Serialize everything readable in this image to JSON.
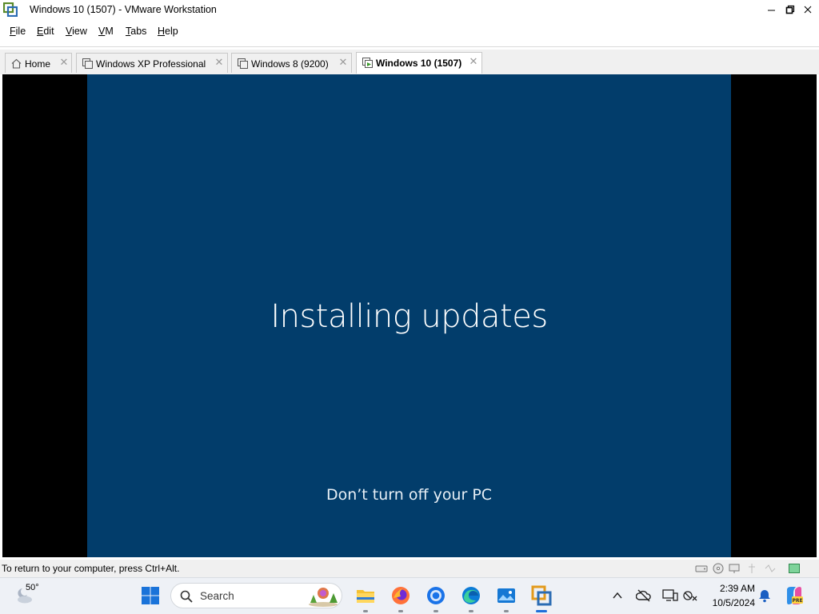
{
  "window": {
    "title": "Windows 10 (1507) - VMware Workstation"
  },
  "menu": {
    "items": [
      {
        "label": "File",
        "key": "F",
        "rest": "ile"
      },
      {
        "label": "Edit",
        "key": "E",
        "rest": "dit"
      },
      {
        "label": "View",
        "key": "V",
        "rest": "iew"
      },
      {
        "label": "VM",
        "key": "V",
        "rest": "M"
      },
      {
        "label": "Tabs",
        "key": "T",
        "rest": "abs"
      },
      {
        "label": "Help",
        "key": "H",
        "rest": "elp"
      }
    ]
  },
  "tabs": [
    {
      "label": "Home",
      "icon": "home-icon",
      "active": false
    },
    {
      "label": "Windows XP Professional",
      "icon": "vm-icon",
      "active": false
    },
    {
      "label": "Windows 8 (9200)",
      "icon": "vm-icon",
      "active": false
    },
    {
      "label": "Windows 10 (1507)",
      "icon": "vm-running-icon",
      "active": true
    }
  ],
  "vm_screen": {
    "main_text": "Installing updates",
    "sub_text": "Don’t turn off your PC",
    "background_color": "#023d6b"
  },
  "statusbar": {
    "message": "To return to your computer, press Ctrl+Alt."
  },
  "taskbar": {
    "weather_temp": "50°",
    "search_placeholder": "Search",
    "clock_time": "2:39 AM",
    "clock_date": "10/5/2024",
    "apps": [
      "start-icon",
      "file-explorer-icon",
      "firefox-icon",
      "chrome-icon",
      "edge-icon",
      "photos-icon",
      "vmware-icon"
    ]
  }
}
